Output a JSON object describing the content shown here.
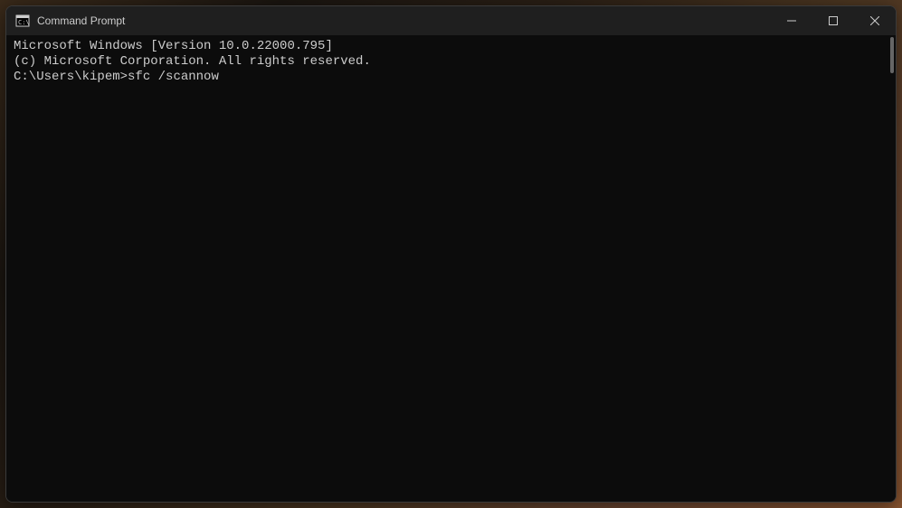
{
  "titlebar": {
    "title": "Command Prompt"
  },
  "terminal": {
    "line1": "Microsoft Windows [Version 10.0.22000.795]",
    "line2": "(c) Microsoft Corporation. All rights reserved.",
    "blank": "",
    "prompt": "C:\\Users\\kipem>",
    "command": "sfc /scannow"
  }
}
